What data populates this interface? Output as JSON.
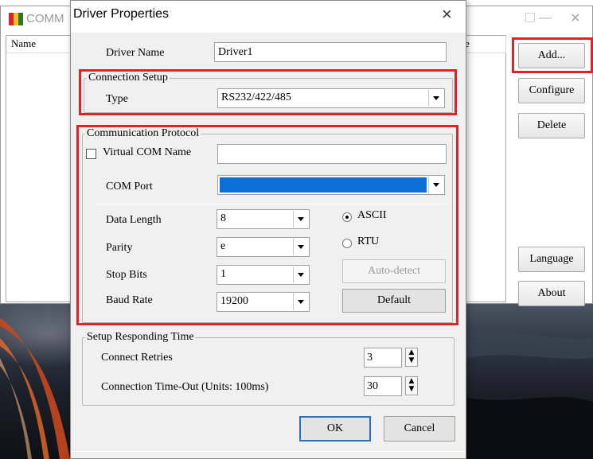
{
  "background_window": {
    "title": "COMM",
    "columns": [
      "Name",
      "e"
    ],
    "buttons": {
      "add": "Add...",
      "configure": "Configure",
      "delete": "Delete",
      "language": "Language",
      "about": "About"
    }
  },
  "dialog": {
    "title": "Driver Properties",
    "close_glyph": "×",
    "driver_name": {
      "label": "Driver Name",
      "value": "Driver1"
    },
    "connection_setup": {
      "title": "Connection Setup",
      "type_label": "Type",
      "type_value": "RS232/422/485"
    },
    "communication_protocol": {
      "title": "Communication Protocol",
      "virtual_com_label": "Virtual COM Name",
      "virtual_com_value": "",
      "com_port_label": "COM Port",
      "com_port_value": "",
      "data_length_label": "Data Length",
      "data_length_value": "8",
      "parity_label": "Parity",
      "parity_value": "e",
      "stop_bits_label": "Stop Bits",
      "stop_bits_value": "1",
      "baud_rate_label": "Baud Rate",
      "baud_rate_value": "19200",
      "mode_ascii": "ASCII",
      "mode_rtu": "RTU",
      "auto_detect_label": "Auto-detect",
      "default_label": "Default"
    },
    "responding_time": {
      "title": "Setup Responding Time",
      "retries_label": "Connect Retries",
      "retries_value": "3",
      "timeout_label": "Connection Time-Out (Units: 100ms)",
      "timeout_value": "30"
    },
    "ok_label": "OK",
    "cancel_label": "Cancel"
  },
  "colors": {
    "highlight_red": "#e0202a",
    "selection_blue": "#0a6fd6"
  },
  "icons": [
    "app-logo-icon",
    "minimize-icon",
    "maximize-icon",
    "close-icon",
    "dropdown-arrow-icon",
    "spin-up-icon",
    "spin-down-icon"
  ]
}
